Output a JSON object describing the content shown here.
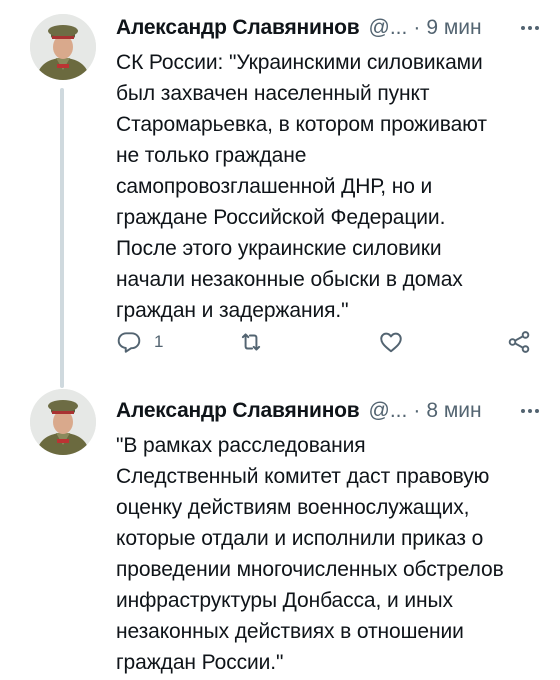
{
  "tweets": [
    {
      "author": "Александр Славянинов",
      "handle": "@...",
      "time": "9 мин",
      "text": "СК России: \"Украинскими силовиками\nбыл захвачен населенный пункт\nСтаромарьевка, в котором проживают\nне только граждане\nсамопровозглашенной ДНР, но и\nграждане Российской Федерации.\nПосле этого украинские силовики\nначали незаконные обыски в домах\nграждан и задержания.\"",
      "reply_count": "1"
    },
    {
      "author": "Александр Славянинов",
      "handle": "@...",
      "time": "8 мин",
      "text": "\"В рамках расследования\nСледственный комитет даст правовую\nоценку действиям военнослужащих,\nкоторые отдали и исполнили приказ о\nпроведении многочисленных обстрелов\nинфраструктуры Донбасса, и иных\nнезаконных действиях в отношении\nграждан России.\""
    }
  ],
  "separator": "·",
  "icons": {
    "more": "more-horizontal-icon",
    "reply": "reply-icon",
    "retweet": "retweet-icon",
    "like": "like-icon",
    "share": "share-icon"
  },
  "colors": {
    "text": "#0f1419",
    "secondary": "#536471",
    "thread_line": "#cfd9de"
  }
}
